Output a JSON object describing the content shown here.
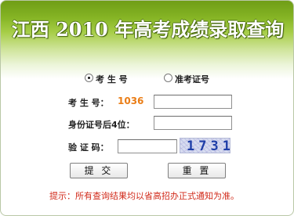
{
  "header": {
    "title": "江西 2010 年高考成绩录取查询"
  },
  "query_type": {
    "options": [
      "考 生 号",
      "准考证号"
    ],
    "selected": "考 生 号"
  },
  "form": {
    "exam_no_label": "考 生 号：",
    "exam_no_prefix": "1036",
    "exam_no_value": "",
    "id_last4_label": "身份证号后4位：",
    "id_last4_value": "",
    "captcha_label": "验 证 码：",
    "captcha_value": "",
    "captcha_code": "1731"
  },
  "actions": {
    "submit_label": "提 交",
    "reset_label": "重 置"
  },
  "hint": "提示：所有查询结果均以省高招办正式通知为准。",
  "colors": {
    "header_green": "#7aa81c",
    "prefix_orange": "#ea7d16",
    "hint_red": "#d12a1a",
    "captcha_blue": "#1f3ea8"
  }
}
